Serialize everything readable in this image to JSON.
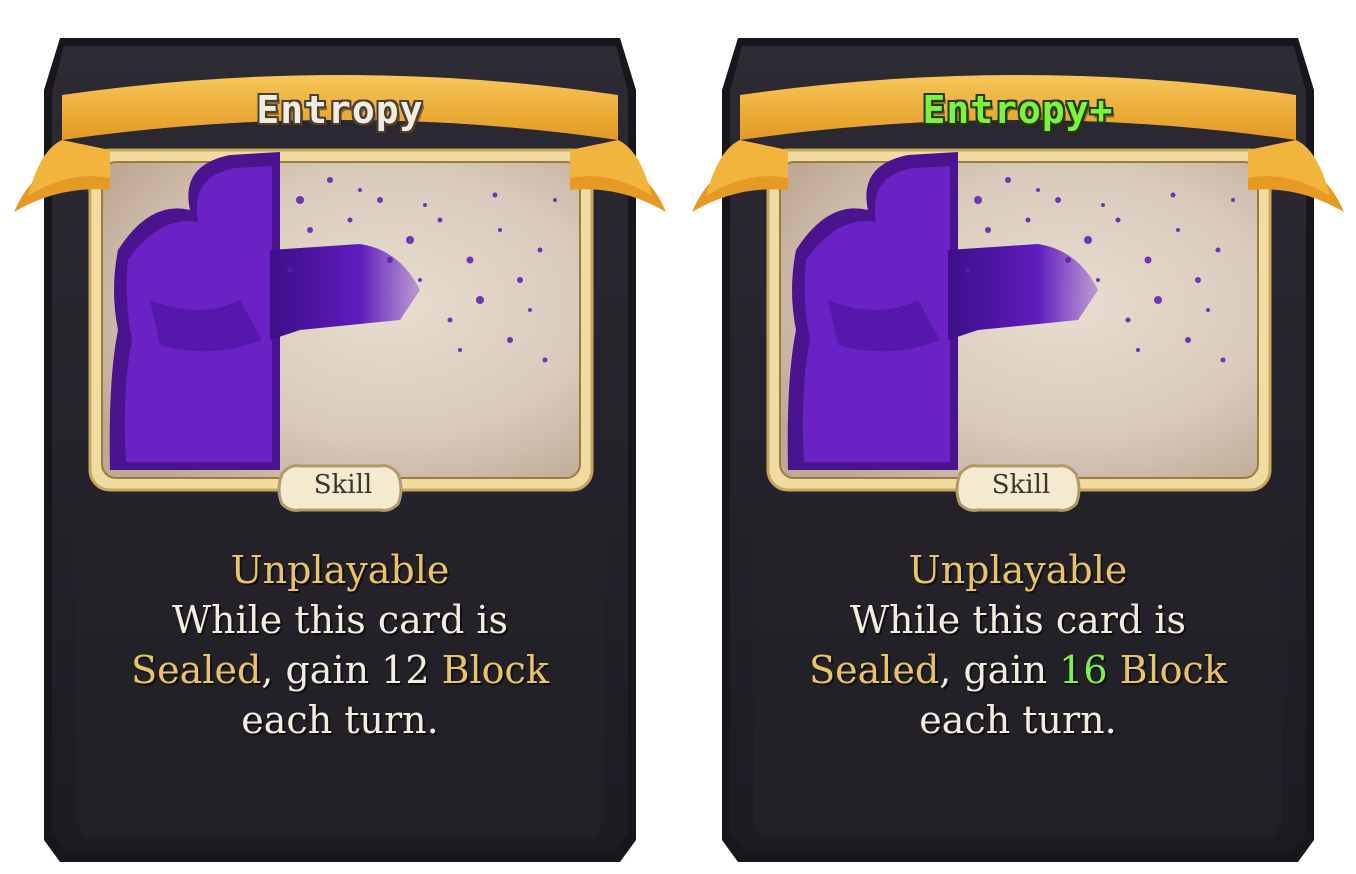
{
  "cards": [
    {
      "title": "Entropy",
      "type": "Skill",
      "keyword": "Unplayable",
      "line2": "While this card is",
      "sealed_word": "Sealed",
      "gain_text": ", gain ",
      "block_amount": "12",
      "block_word": "Block",
      "line4": "each turn.",
      "upgraded": false
    },
    {
      "title": "Entropy+",
      "type": "Skill",
      "keyword": "Unplayable",
      "line2": "While this card is",
      "sealed_word": "Sealed",
      "gain_text": ", gain ",
      "block_amount": "16",
      "block_word": "Block",
      "line4": "each turn.",
      "upgraded": true
    }
  ],
  "colors": {
    "card_body": "#2a2630",
    "banner": "#f2b23e",
    "frame": "#f3e6a8",
    "keyword": "#e9c466",
    "upgrade": "#7cf43c",
    "art_silhouette": "#5a1aa8"
  }
}
